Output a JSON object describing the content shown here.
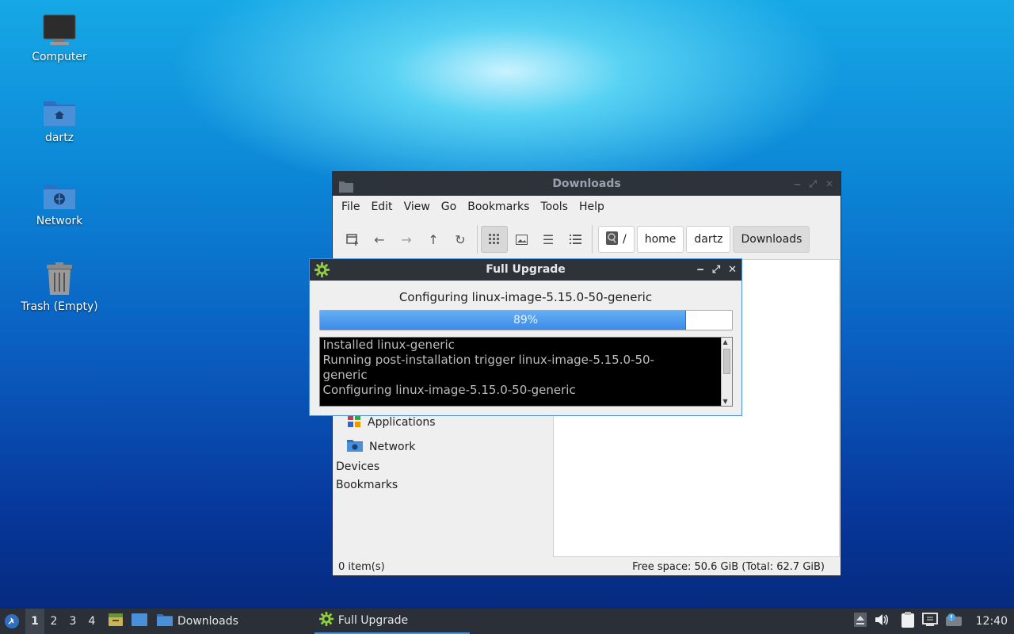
{
  "desktop": {
    "icons": [
      {
        "label": "Computer"
      },
      {
        "label": "dartz"
      },
      {
        "label": "Network"
      },
      {
        "label": "Trash (Empty)"
      }
    ]
  },
  "file_manager": {
    "title": "Downloads",
    "menu": [
      "File",
      "Edit",
      "View",
      "Go",
      "Bookmarks",
      "Tools",
      "Help"
    ],
    "breadcrumbs": [
      "/",
      "home",
      "dartz",
      "Downloads"
    ],
    "sidebar": {
      "items": [
        "Applications",
        "Network"
      ],
      "sections": [
        "Devices",
        "Bookmarks"
      ]
    },
    "status_left": "0 item(s)",
    "status_right": "Free space: 50.6 GiB (Total: 62.7 GiB)"
  },
  "dialog": {
    "title": "Full Upgrade",
    "message": "Configuring linux-image-5.15.0-50-generic",
    "progress": 0.89,
    "progress_label": "89%",
    "log_lines": [
      "Installed linux-generic",
      "Running post-installation trigger linux-image-5.15.0-50-",
      "generic",
      "Configuring linux-image-5.15.0-50-generic"
    ]
  },
  "taskbar": {
    "workspaces": [
      "1",
      "2",
      "3",
      "4"
    ],
    "tasks": [
      {
        "label": "Downloads"
      },
      {
        "label": "Full Upgrade"
      }
    ],
    "clock": "12:40"
  },
  "colors": {
    "accent": "#4a90d9",
    "titlebar": "#2e333a",
    "progress_fill": "#3d8be8"
  }
}
